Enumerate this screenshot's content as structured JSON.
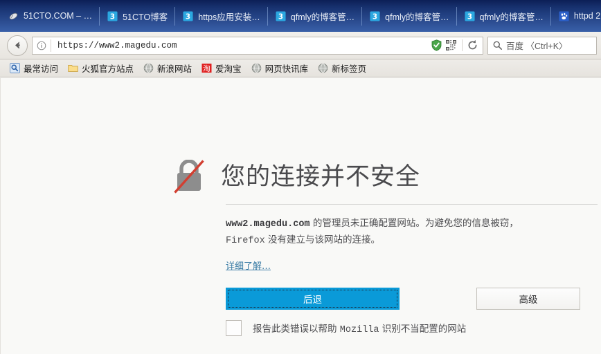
{
  "window": {
    "tabs": [
      {
        "icon": "mouse-icon",
        "label": "51CTO.COM – …"
      },
      {
        "icon": "51cto-icon",
        "label": "51CTO博客"
      },
      {
        "icon": "51cto-icon",
        "label": "https应用安装…"
      },
      {
        "icon": "51cto-icon",
        "label": "qfmly的博客管…"
      },
      {
        "icon": "51cto-icon",
        "label": "qfmly的博客管…"
      },
      {
        "icon": "51cto-icon",
        "label": "qfmly的博客管…"
      },
      {
        "icon": "baidu-paw-icon",
        "label": "httpd 2"
      }
    ]
  },
  "navbar": {
    "back_icon": "back-arrow-icon",
    "identity_icon": "info-circle-icon",
    "url": "https://www2.magedu.com",
    "shield_icon": "green-shield-icon",
    "qr_icon": "qr-code-icon",
    "reload_icon": "reload-icon",
    "search": {
      "icon": "search-icon",
      "placeholder": "百度 〈Ctrl+K〉"
    }
  },
  "bookmarks": [
    {
      "icon": "most-visited-icon",
      "label": "最常访问"
    },
    {
      "icon": "folder-icon",
      "label": "火狐官方站点"
    },
    {
      "icon": "globe-icon",
      "label": "新浪网站"
    },
    {
      "icon": "taobao-icon",
      "label": "爱淘宝"
    },
    {
      "icon": "globe-icon",
      "label": "网页快讯库"
    },
    {
      "icon": "globe-icon",
      "label": "新标签页"
    }
  ],
  "error_page": {
    "lock_icon": "broken-lock-icon",
    "title": "您的连接并不安全",
    "body_prefix": "www2.magedu.com",
    "body_middle": " 的管理员未正确配置网站。为避免您的信息被窃，",
    "body_firefox": "Firefox",
    "body_suffix": " 没有建立与该网站的连接。",
    "learn_more": "详细了解…",
    "back_button": "后退",
    "advanced_button": "高级",
    "report_label_1": "报告此类错误以帮助 ",
    "report_label_mozilla": "Mozilla",
    "report_label_2": " 识别不当配置的网站"
  },
  "colors": {
    "titlebar": "#112a67",
    "accent_button": "#0a9ad8",
    "link": "#3a7ca5",
    "shield_green": "#4aa64a",
    "slash_red": "#d23f31"
  }
}
